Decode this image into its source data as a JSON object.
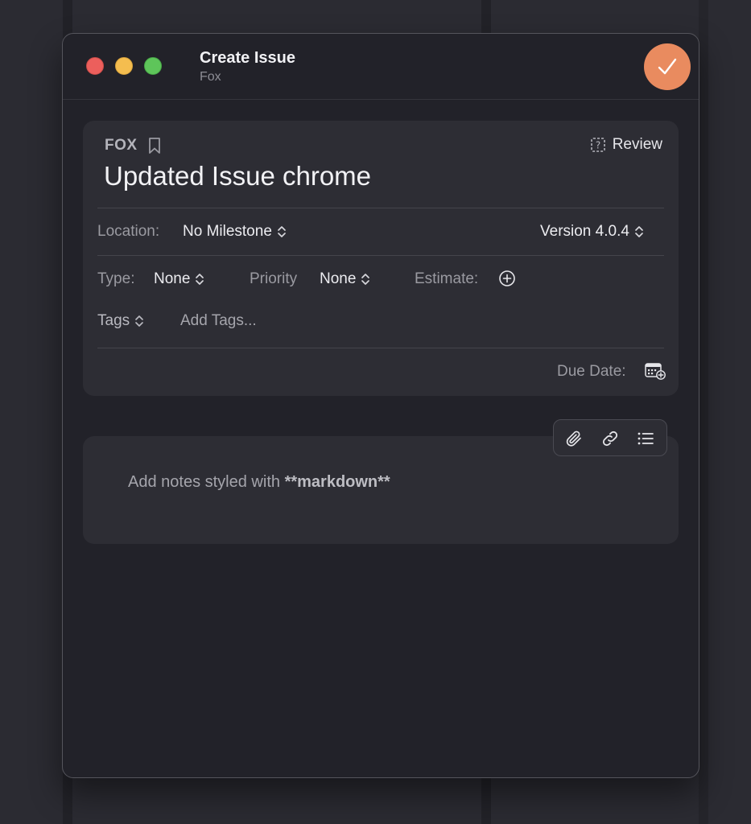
{
  "window": {
    "title": "Create Issue",
    "subtitle": "Fox",
    "confirm_icon": "checkmark-icon",
    "accent": "#e98b5f"
  },
  "issue": {
    "project": "FOX",
    "review_label": "Review",
    "title": "Updated Issue chrome"
  },
  "fields": {
    "location_label": "Location:",
    "location_value": "No Milestone",
    "version_value": "Version 4.0.4",
    "type_label": "Type:",
    "type_value": "None",
    "priority_label": "Priority",
    "priority_value": "None",
    "estimate_label": "Estimate:",
    "tags_label": "Tags",
    "tags_placeholder": "Add Tags...",
    "due_date_label": "Due Date:"
  },
  "notes": {
    "prefix": "Add notes styled with ",
    "bold": "**markdown**",
    "toolbar_icons": [
      "paperclip-icon",
      "link-icon",
      "list-icon"
    ]
  }
}
